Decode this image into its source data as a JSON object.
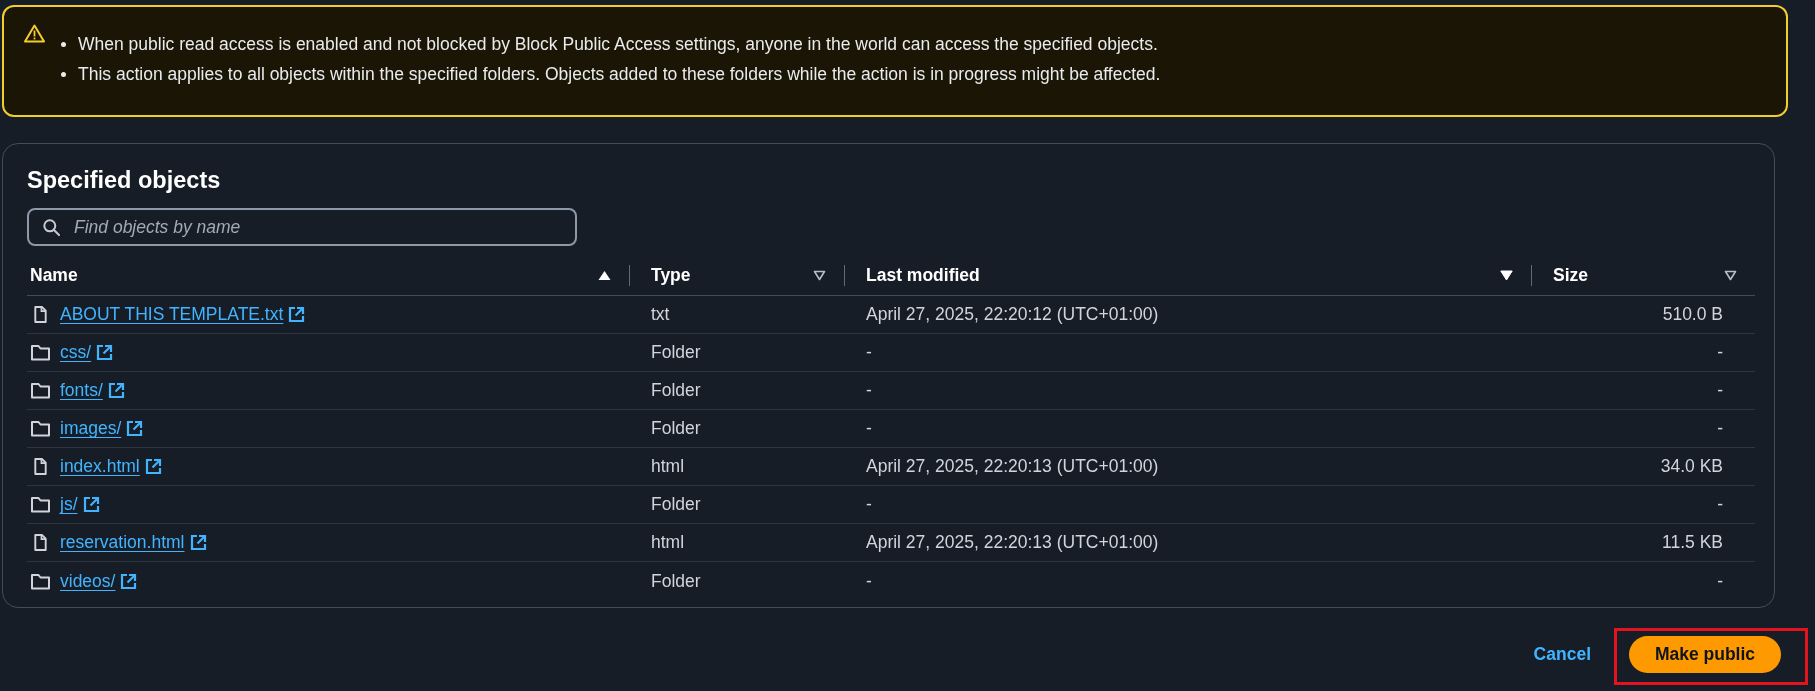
{
  "alert": {
    "kind": "warning",
    "items": [
      "When public read access is enabled and not blocked by Block Public Access settings, anyone in the world can access the specified objects.",
      "This action applies to all objects within the specified folders. Objects added to these folders while the action is in progress might be affected."
    ]
  },
  "objects_panel": {
    "title": "Specified objects",
    "search": {
      "placeholder": "Find objects by name"
    },
    "table": {
      "columns": [
        {
          "label": "Name",
          "sorted": true,
          "descending": false
        },
        {
          "label": "Type",
          "sorted": false,
          "descending": true
        },
        {
          "label": "Last modified",
          "sorted": true,
          "descending": true
        },
        {
          "label": "Size",
          "sorted": false,
          "descending": true
        }
      ],
      "rows": [
        {
          "kind": "file",
          "name": "ABOUT THIS TEMPLATE.txt",
          "type": "txt",
          "last_modified": "April 27, 2025, 22:20:12 (UTC+01:00)",
          "size": "510.0 B"
        },
        {
          "kind": "folder",
          "name": "css/",
          "type": "Folder",
          "last_modified": "-",
          "size": "-"
        },
        {
          "kind": "folder",
          "name": "fonts/",
          "type": "Folder",
          "last_modified": "-",
          "size": "-"
        },
        {
          "kind": "folder",
          "name": "images/",
          "type": "Folder",
          "last_modified": "-",
          "size": "-"
        },
        {
          "kind": "file",
          "name": "index.html",
          "type": "html",
          "last_modified": "April 27, 2025, 22:20:13 (UTC+01:00)",
          "size": "34.0 KB"
        },
        {
          "kind": "folder",
          "name": "js/",
          "type": "Folder",
          "last_modified": "-",
          "size": "-"
        },
        {
          "kind": "file",
          "name": "reservation.html",
          "type": "html",
          "last_modified": "April 27, 2025, 22:20:13 (UTC+01:00)",
          "size": "11.5 KB"
        },
        {
          "kind": "folder",
          "name": "videos/",
          "type": "Folder",
          "last_modified": "-",
          "size": "-"
        }
      ]
    }
  },
  "footer": {
    "cancel": "Cancel",
    "confirm": "Make public",
    "confirm_highlighted": true
  }
}
